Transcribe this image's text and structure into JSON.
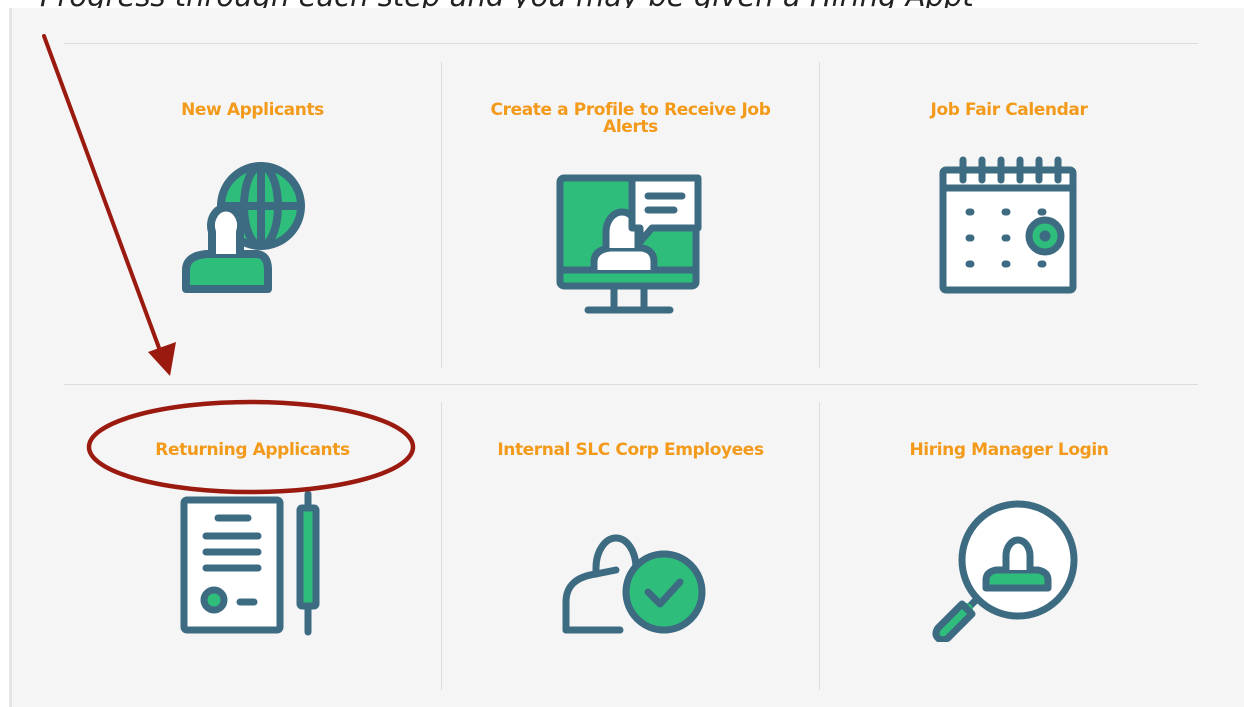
{
  "top_text": "Progress through each step and you may be given a Hiring Appt",
  "tiles": [
    {
      "title": "New Applicants",
      "icon": "globe-user-icon"
    },
    {
      "title": "Create a Profile to Receive Job Alerts",
      "icon": "monitor-user-chat-icon"
    },
    {
      "title": "Job Fair Calendar",
      "icon": "calendar-icon"
    },
    {
      "title": "Returning Applicants",
      "icon": "document-pen-icon"
    },
    {
      "title": "Internal SLC Corp Employees",
      "icon": "user-check-icon"
    },
    {
      "title": "Hiring Manager Login",
      "icon": "magnifier-user-icon"
    }
  ],
  "colors": {
    "title": "#f39a1a",
    "icon_stroke": "#3d6b82",
    "icon_fill": "#2fbd7c",
    "annotation": "#9b1a10",
    "panel_bg": "#f5f5f5"
  }
}
